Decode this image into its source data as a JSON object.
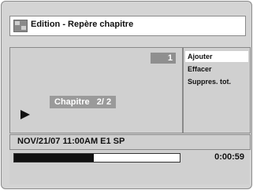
{
  "window": {
    "title": "Edition - Repère chapitre",
    "icon": "chapter-edit-icon"
  },
  "preview": {
    "chapter_number": "1",
    "chapter_label": "Chapitre   2/ 2",
    "play_icon": "play-icon"
  },
  "menu": {
    "items": [
      {
        "label": "Ajouter",
        "selected": true
      },
      {
        "label": "Effacer",
        "selected": false
      },
      {
        "label": "Suppres. tot.",
        "selected": false
      }
    ]
  },
  "status": {
    "text": "NOV/21/07 11:00AM E1 SP"
  },
  "playback": {
    "progress": 0.48,
    "time": "0:00:59"
  },
  "colors": {
    "frame_bg": "#d4d4d4",
    "panel_bg": "#d0d0d0",
    "label_bg": "#9a9a9a",
    "progress_fill": "#111111"
  }
}
